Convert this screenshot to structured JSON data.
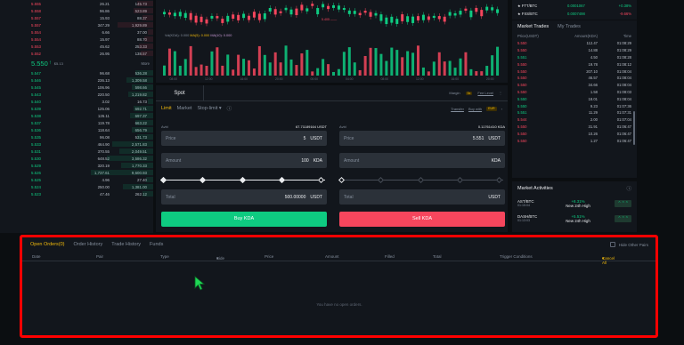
{
  "orderbook": {
    "asks": [
      {
        "price": "5.555",
        "amount": "26.21",
        "total": "145.73"
      },
      {
        "price": "5.558",
        "amount": "96.86",
        "total": "523.89"
      },
      {
        "price": "5.557",
        "amount": "15.93",
        "total": "88.37"
      },
      {
        "price": "5.557",
        "amount": "347.29",
        "total": "1,929.89"
      },
      {
        "price": "5.554",
        "amount": "6.66",
        "total": "37.00"
      },
      {
        "price": "5.554",
        "amount": "15.97",
        "total": "88.70"
      },
      {
        "price": "5.553",
        "amount": "45.62",
        "total": "253.33"
      },
      {
        "price": "5.552",
        "amount": "26.95",
        "total": "138.57"
      }
    ],
    "last_price": "5.550",
    "last_price_usd": "$5.13",
    "more_label": "More",
    "bids": [
      {
        "price": "5.547",
        "amount": "96.68",
        "total": "536.28"
      },
      {
        "price": "5.546",
        "amount": "236.13",
        "total": "1,309.58"
      },
      {
        "price": "5.545",
        "amount": "106.96",
        "total": "598.66"
      },
      {
        "price": "5.543",
        "amount": "220.50",
        "total": "1,219.82"
      },
      {
        "price": "5.540",
        "amount": "3.02",
        "total": "16.73"
      },
      {
        "price": "5.539",
        "amount": "125.06",
        "total": "692.71"
      },
      {
        "price": "5.538",
        "amount": "126.11",
        "total": "697.37"
      },
      {
        "price": "5.537",
        "amount": "119.78",
        "total": "663.22"
      },
      {
        "price": "5.536",
        "amount": "118.64",
        "total": "656.79"
      },
      {
        "price": "5.535",
        "amount": "96.08",
        "total": "531.73"
      },
      {
        "price": "5.533",
        "amount": "464.90",
        "total": "2,571.83"
      },
      {
        "price": "5.531",
        "amount": "370.55",
        "total": "2,049.51"
      },
      {
        "price": "5.530",
        "amount": "648.52",
        "total": "3,586.32"
      },
      {
        "price": "5.529",
        "amount": "320.19",
        "total": "1,770.33"
      },
      {
        "price": "5.526",
        "amount": "1,737.61",
        "total": "9,600.93"
      },
      {
        "price": "5.525",
        "amount": "4.96",
        "total": "27.40"
      },
      {
        "price": "5.524",
        "amount": "250.00",
        "total": "1,381.00"
      },
      {
        "price": "5.523",
        "amount": "47.46",
        "total": "262.12"
      }
    ],
    "colors": {
      "ask": "#f6465d",
      "bid": "#0ecb81"
    }
  },
  "chart": {
    "volume_legend": "Vol(KDA): 0.000",
    "vol_ma5": "MA(5): 0.000",
    "vol_ma10": "MA(10): 0.000",
    "mini_legend": "5.405 ——",
    "time_labels": [
      "08:00",
      "12:00",
      "16:00",
      "20:00",
      "00:00",
      "04:00",
      "08:00",
      "12:00",
      "16:00",
      "20:00"
    ]
  },
  "trade_form": {
    "tab_spot": "Spot",
    "margin_label": "Margin",
    "margin_tag": "5x",
    "fee_level_label": "Fee Level",
    "order_types": {
      "limit": "Limit",
      "market": "Market",
      "stop_limit": "Stop-limit"
    },
    "transfer_label": "Transfer",
    "buy_with_label": "Buy with",
    "buy_with_tag": "EUR",
    "buy": {
      "avail_label": "Avbl",
      "avail_value": "67.71189164 USDT",
      "price_label": "Price",
      "price_value": "5",
      "price_unit": "USDT",
      "amount_label": "Amount",
      "amount_value": "100",
      "amount_unit": "KDA",
      "total_label": "Total",
      "total_value": "500.00000",
      "total_unit": "USDT",
      "button": "Buy KDA"
    },
    "sell": {
      "avail_label": "Avbl",
      "avail_value": "0.11761410 KDA",
      "price_label": "Price",
      "price_value": "5.551",
      "price_unit": "USDT",
      "amount_label": "Amount",
      "amount_value": "",
      "amount_unit": "KDA",
      "total_label": "Total",
      "total_value": "",
      "total_unit": "USDT",
      "button": "Sell KDA"
    }
  },
  "pairs_ticker": [
    {
      "name": "★ FTT/BTC",
      "price": "0.0001067",
      "change": "+0.38%"
    },
    {
      "name": "★ FXS/BTC",
      "price": "0.0007498",
      "change": "-9.66%"
    }
  ],
  "market_trades": {
    "tab_trades": "Market Trades",
    "tab_mine": "My Trades",
    "headers": {
      "price": "Price(USDT)",
      "amount": "Amount(KDA)",
      "time": "Time"
    },
    "rows": [
      {
        "side": "sell",
        "price": "5.550",
        "amount": "112.47",
        "time": "01:08:29"
      },
      {
        "side": "sell",
        "price": "5.550",
        "amount": "14.88",
        "time": "01:08:29"
      },
      {
        "side": "buy",
        "price": "5.551",
        "amount": "4.50",
        "time": "01:08:28"
      },
      {
        "side": "sell",
        "price": "5.550",
        "amount": "19.78",
        "time": "01:08:12"
      },
      {
        "side": "sell",
        "price": "5.550",
        "amount": "207.10",
        "time": "01:08:04"
      },
      {
        "side": "sell",
        "price": "5.550",
        "amount": "46.57",
        "time": "01:08:04"
      },
      {
        "side": "sell",
        "price": "5.550",
        "amount": "34.66",
        "time": "01:08:04"
      },
      {
        "side": "sell",
        "price": "5.550",
        "amount": "1.58",
        "time": "01:08:03"
      },
      {
        "side": "buy",
        "price": "5.550",
        "amount": "18.01",
        "time": "01:08:04"
      },
      {
        "side": "buy",
        "price": "5.550",
        "amount": "9.23",
        "time": "01:07:36"
      },
      {
        "side": "buy",
        "price": "5.551",
        "amount": "11.29",
        "time": "01:07:31"
      },
      {
        "side": "sell",
        "price": "5.544",
        "amount": "2.00",
        "time": "01:07:04"
      },
      {
        "side": "sell",
        "price": "5.550",
        "amount": "31.91",
        "time": "01:06:47"
      },
      {
        "side": "sell",
        "price": "5.550",
        "amount": "10.26",
        "time": "01:06:47"
      },
      {
        "side": "sell",
        "price": "5.550",
        "amount": "1.27",
        "time": "01:06:47"
      }
    ]
  },
  "market_activities": {
    "title": "Market Activities",
    "rows": [
      {
        "pair": "AST/BTC",
        "time": "01:15:04",
        "pct": "+8.31%",
        "label": "New 24h High"
      },
      {
        "pair": "DASH/BTC",
        "time": "01:13:03",
        "pct": "+5.51%",
        "label": "New 24h High"
      }
    ]
  },
  "orders_panel": {
    "tabs": [
      "Open Orders(0)",
      "Order History",
      "Trade History",
      "Funds"
    ],
    "hide_other_pairs": "Hide Other Pairs",
    "columns": [
      "Date",
      "Pair",
      "Type",
      "Side",
      "Price",
      "Amount",
      "Filled",
      "Total",
      "Trigger Conditions",
      "Cancel All"
    ],
    "empty_text": "You have no open orders.",
    "highlight_color": "#ff0000"
  }
}
